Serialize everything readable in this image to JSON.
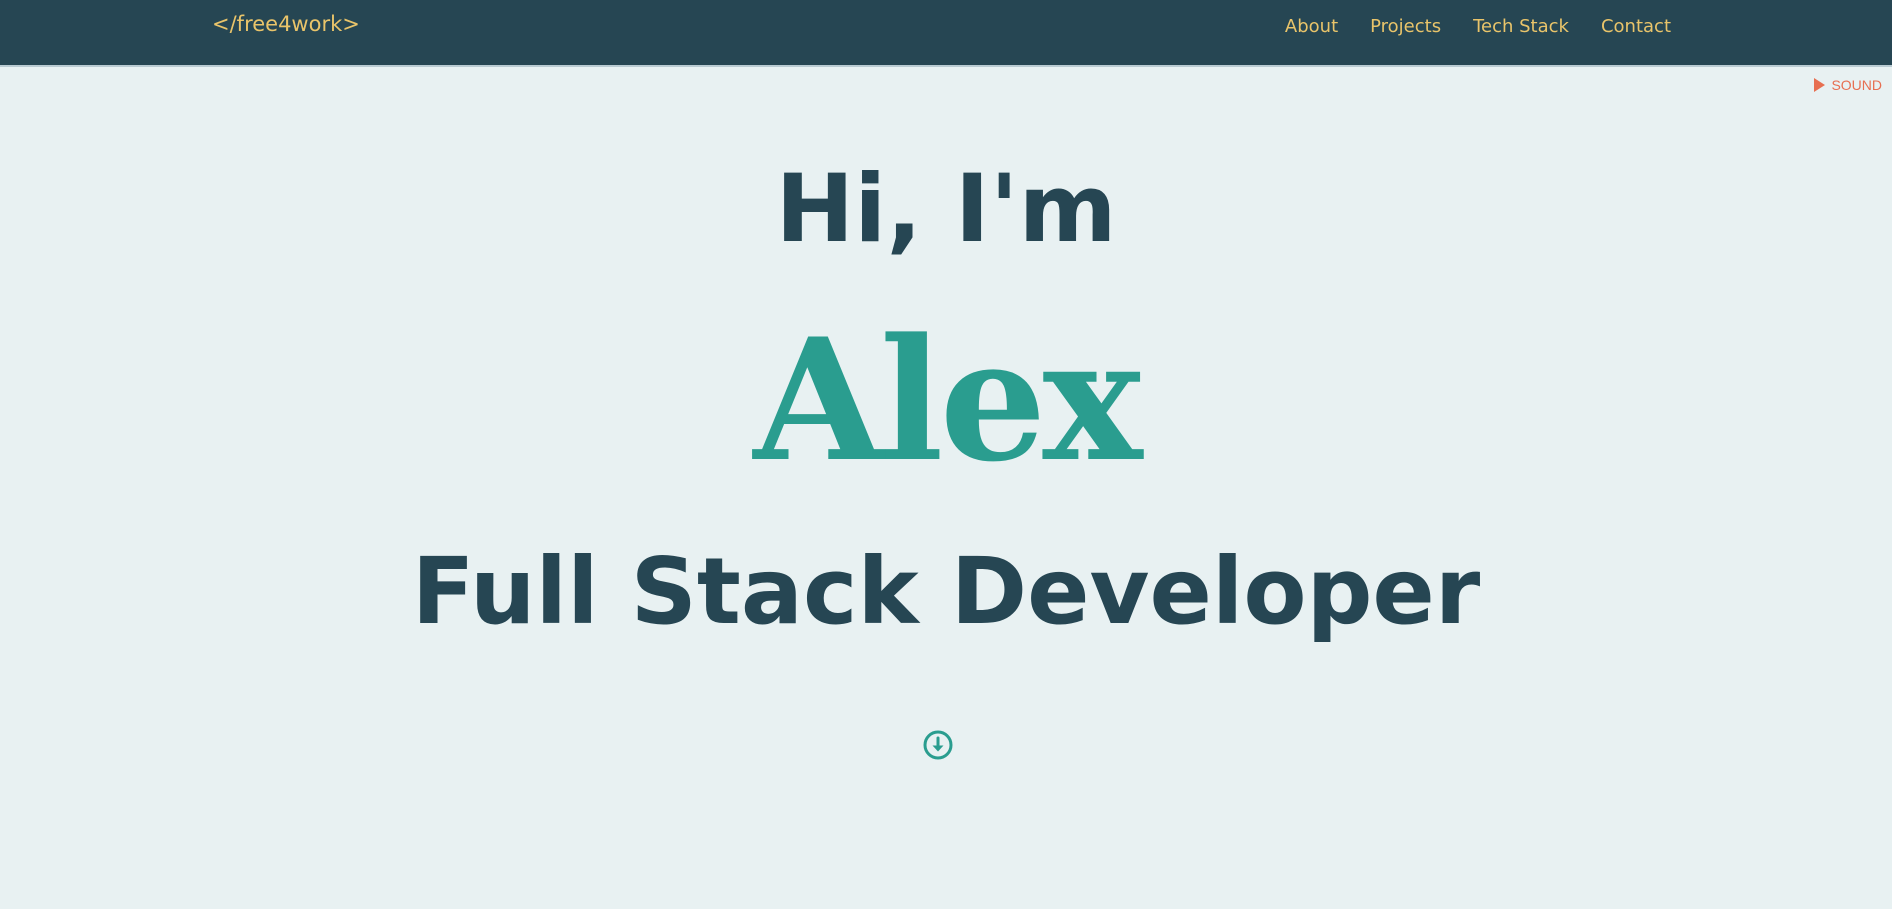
{
  "header": {
    "brand": "</free4work>",
    "nav": [
      {
        "label": "About"
      },
      {
        "label": "Projects"
      },
      {
        "label": "Tech Stack"
      },
      {
        "label": "Contact"
      }
    ]
  },
  "sound": {
    "label": "SOUND",
    "icon": "play-icon"
  },
  "hero": {
    "greeting": "Hi, I'm",
    "name": "Alex",
    "role": "Full Stack Developer",
    "scroll_icon": "arrow-down-circle-icon"
  },
  "colors": {
    "navbar_bg": "#264653",
    "nav_text": "#e9c46a",
    "page_bg": "#e8f1f2",
    "heading": "#264653",
    "accent": "#2a9d8f",
    "sound": "#e76f51"
  }
}
